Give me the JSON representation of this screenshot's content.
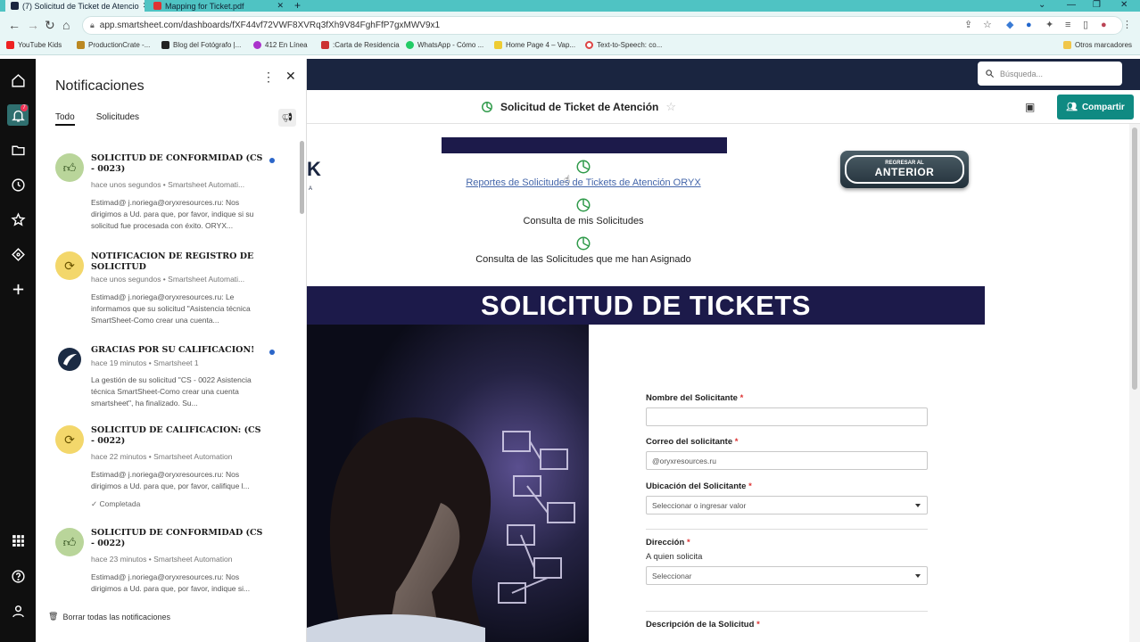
{
  "browser": {
    "tabs": [
      {
        "label": "(7) Solicitud de Ticket de Atencio",
        "active": true
      },
      {
        "label": "Mapping for Ticket.pdf",
        "active": false
      }
    ],
    "url": "app.smartsheet.com/dashboards/fXF44vf72VWF8XVRq3fXh9V84FghFfP7gxMWV9x1",
    "bookmarks": [
      "YouTube Kids",
      "ProductionCrate -...",
      "Blog del Fotógrafo |...",
      "412 En Línea",
      ":Carta de Residencia",
      "WhatsApp - Cómo ...",
      "Home Page 4 – Vap...",
      "Text-to-Speech: co..."
    ],
    "other_bookmarks": "Otros marcadores"
  },
  "rail": {
    "notif_badge": "7"
  },
  "notifications": {
    "title": "Notificaciones",
    "tabs": [
      "Todo",
      "Solicitudes"
    ],
    "items": [
      {
        "icon": "thumbs-up-icon",
        "title": "SOLICITUD DE CONFORMIDAD (CS - 0023)",
        "meta": "hace unos segundos • Smartsheet Automati...",
        "body": "Estimad@ j.noriega@oryxresources.ru: Nos dirigimos a Ud. para que, por favor, indique si su solicitud fue procesada con éxito. ORYX...",
        "unread": true
      },
      {
        "icon": "refresh-icon",
        "title": "NOTIFICACION DE REGISTRO DE SOLICITUD",
        "meta": "hace unos segundos • Smartsheet Automati...",
        "body": "Estimad@ j.noriega@oryxresources.ru: Le informamos que su solicitud \"Asistencia técnica SmartSheet-Como crear una cuenta...",
        "unread": false
      },
      {
        "icon": "smartsheet-logo-icon",
        "title": "GRACIAS POR SU CALIFICACION!",
        "meta": "hace 19 minutos • Smartsheet 1",
        "body": "La gestión de su solicitud \"CS - 0022 Asistencia técnica SmartSheet-Como crear una cuenta smartsheet\", ha finalizado. Su...",
        "unread": true
      },
      {
        "icon": "refresh-icon",
        "title": "SOLICITUD DE CALIFICACION: (CS - 0022)",
        "meta": "hace 22 minutos • Smartsheet Automation",
        "body": "Estimad@ j.noriega@oryxresources.ru: Nos dirigimos a Ud. para que, por favor, califique l...",
        "status": "Completada",
        "unread": false
      },
      {
        "icon": "thumbs-up-icon",
        "title": "SOLICITUD DE CONFORMIDAD (CS - 0022)",
        "meta": "hace 23 minutos • Smartsheet Automation",
        "body": "Estimad@ j.noriega@oryxresources.ru: Nos dirigimos a Ud. para que, por favor, indique si...",
        "unread": false
      }
    ],
    "clear_all": "Borrar todas las notificaciones"
  },
  "app": {
    "search_placeholder": "Búsqueda...",
    "dashboard_title": "Solicitud de Ticket de Atención",
    "share_label": "Compartir",
    "back_button": {
      "small": "REGRESAR AL",
      "big": "ANTERIOR"
    },
    "links": [
      "Reportes de Solicitudes de Tickets de Atención ORYX",
      "Consulta de mis Solicitudes",
      "Consulta de las Solicitudes que me han Asignado"
    ],
    "banner": "SOLICITUD DE TICKETS"
  },
  "form": {
    "fields": [
      {
        "label": "Nombre del Solicitante",
        "required": true,
        "value": ""
      },
      {
        "label": "Correo del solicitante",
        "required": true,
        "value": "@oryxresources.ru"
      },
      {
        "label": "Ubicación del Solicitante",
        "required": true,
        "placeholder": "Seleccionar o ingresar valor"
      },
      {
        "label": "Dirección",
        "required": true,
        "help": "A quien solicita",
        "placeholder": "Seleccionar"
      },
      {
        "label": "Descripción de la Solicitud",
        "required": true
      }
    ]
  },
  "colors": {
    "browser_teal": "#4fc3c3",
    "app_nav": "#1a2540",
    "banner_navy": "#1c1a4a",
    "share_teal": "#0f8a82"
  }
}
